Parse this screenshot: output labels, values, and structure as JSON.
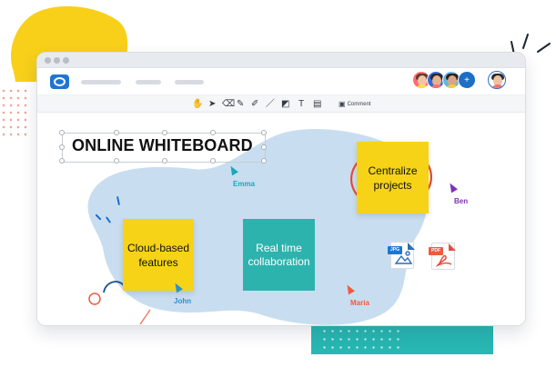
{
  "window": {
    "toolbar_comment": "Comment"
  },
  "whiteboard": {
    "title": "ONLINE WHITEBOARD",
    "notes": {
      "centralize": "Centralize projects",
      "cloud": "Cloud-based features",
      "realtime": "Real time collaboration"
    },
    "cursors": {
      "emma": "Emma",
      "ben": "Ben",
      "john": "John",
      "maria": "Maria"
    },
    "files": {
      "jpg": "JPG",
      "pdf": "PDF"
    }
  },
  "colors": {
    "yellow": "#f6d317",
    "teal": "#2db3ad",
    "blue_blob": "#c8def0",
    "red_circle": "#e54a3d",
    "purple_cursor": "#7d33b5",
    "teal_cursor": "#1aa8b6",
    "blue_cursor": "#2d8fd0",
    "orange_cursor": "#f05b3f"
  },
  "icons": [
    "window-dot-icon",
    "app-logo-icon",
    "hand-tool-icon",
    "pointer-tool-icon",
    "eraser-tool-icon",
    "pen-tool-icon",
    "marker-tool-icon",
    "line-tool-icon",
    "shape-tool-icon",
    "text-tool-icon",
    "note-tool-icon",
    "comment-icon",
    "user-avatar-icon",
    "add-user-icon",
    "image-file-icon",
    "pdf-file-icon"
  ]
}
